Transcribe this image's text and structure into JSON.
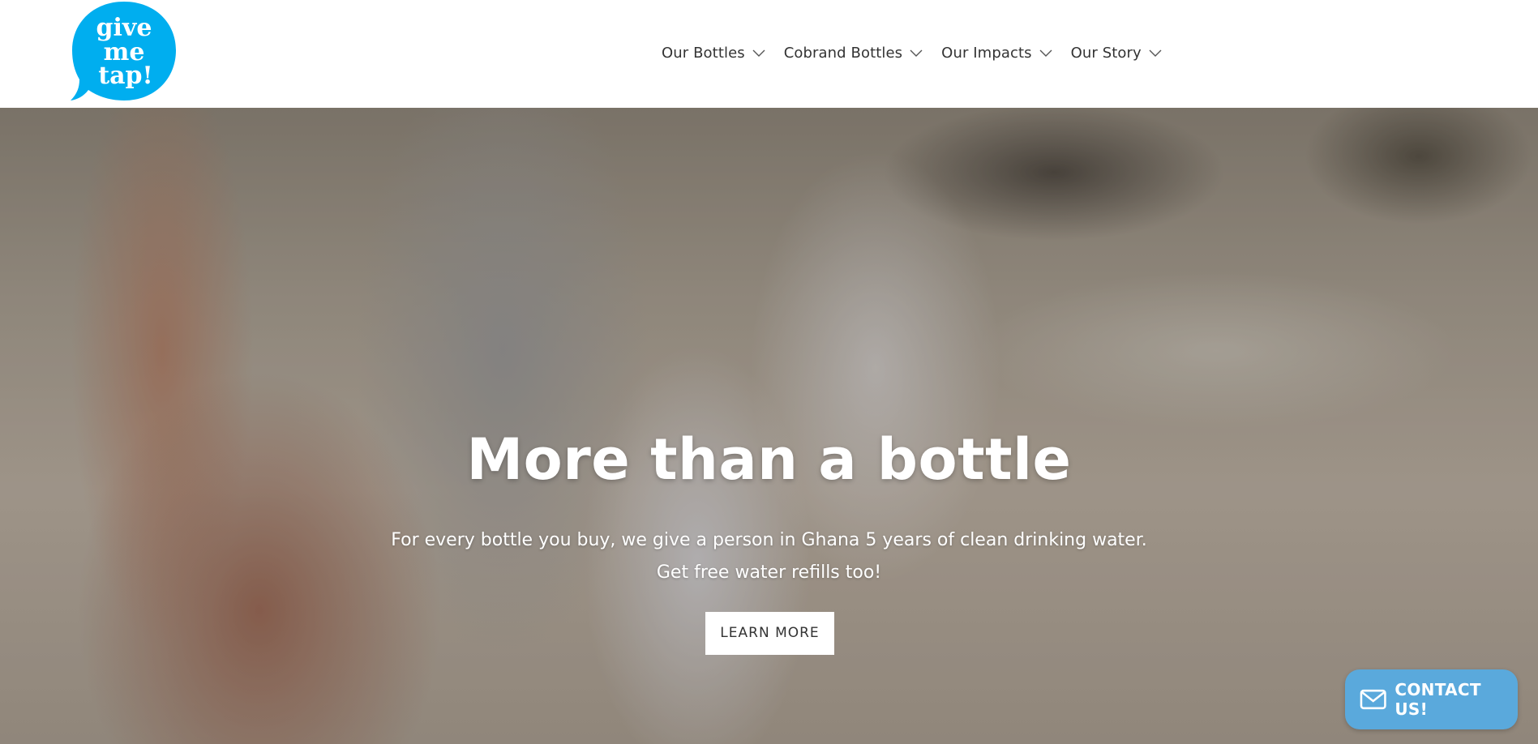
{
  "brand": {
    "logo_lines": [
      "give",
      "me",
      "tap!"
    ],
    "color": "#00aeef"
  },
  "nav": {
    "items": [
      {
        "label": "Our Bottles",
        "icon": "chevron-down-icon"
      },
      {
        "label": "Cobrand Bottles",
        "icon": "chevron-down-icon"
      },
      {
        "label": "Our Impacts",
        "icon": "chevron-down-icon"
      },
      {
        "label": "Our Story",
        "icon": "chevron-down-icon"
      }
    ]
  },
  "hero": {
    "title": "More than a bottle",
    "subtitle_line1": "For every bottle you buy, we give a person in Ghana 5 years of clean drinking water.",
    "subtitle_line2": "Get free water refills too!",
    "cta_label": "LEARN MORE"
  },
  "contact": {
    "label": "CONTACT US!",
    "icon": "envelope-icon",
    "color": "#5aa9dc"
  }
}
